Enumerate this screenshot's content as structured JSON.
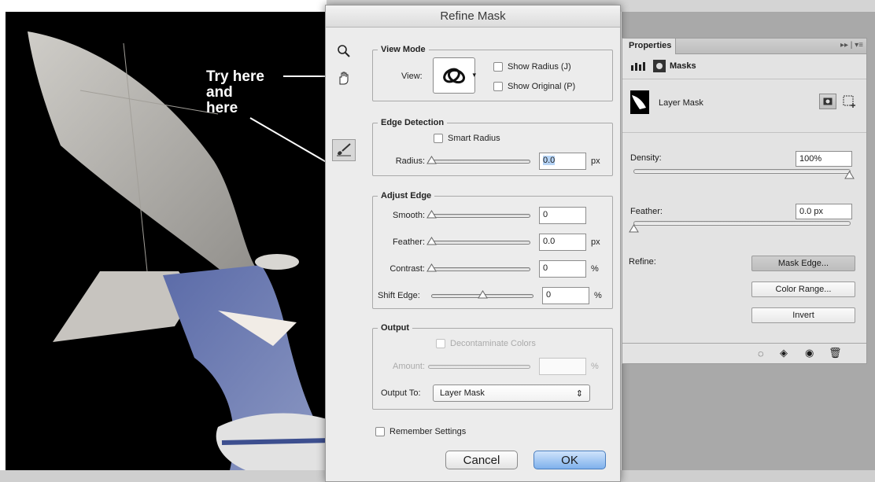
{
  "annotation": {
    "lines": [
      "Try here",
      "and",
      "here"
    ]
  },
  "dialog": {
    "title": "Refine Mask",
    "view_mode": {
      "legend": "View Mode",
      "view_label": "View:",
      "show_radius": "Show Radius (J)",
      "show_original": "Show Original (P)"
    },
    "edge_detection": {
      "legend": "Edge Detection",
      "smart_radius": "Smart Radius",
      "radius_label": "Radius:",
      "radius_value": "0.0",
      "radius_unit": "px"
    },
    "adjust_edge": {
      "legend": "Adjust Edge",
      "smooth_label": "Smooth:",
      "smooth_value": "0",
      "feather_label": "Feather:",
      "feather_value": "0.0",
      "feather_unit": "px",
      "contrast_label": "Contrast:",
      "contrast_value": "0",
      "contrast_unit": "%",
      "shift_label": "Shift Edge:",
      "shift_value": "0",
      "shift_unit": "%"
    },
    "output": {
      "legend": "Output",
      "decontaminate": "Decontaminate Colors",
      "amount_label": "Amount:",
      "amount_unit": "%",
      "output_to_label": "Output To:",
      "output_to_value": "Layer Mask"
    },
    "remember": "Remember Settings",
    "cancel": "Cancel",
    "ok": "OK"
  },
  "properties": {
    "tab": "Properties",
    "section": "Masks",
    "layer_mask": "Layer Mask",
    "density_label": "Density:",
    "density_value": "100%",
    "feather_label": "Feather:",
    "feather_value": "0.0 px",
    "refine_label": "Refine:",
    "mask_edge": "Mask Edge...",
    "color_range": "Color Range...",
    "invert": "Invert"
  },
  "colors": {
    "accent": "#7fb1ec",
    "photo_bg": "#000000",
    "dialog_bg": "#ececec"
  },
  "icons": [
    "zoom-icon",
    "hand-icon",
    "refine-brush-icon",
    "view-thumbnail-icon",
    "mask-icon",
    "vector-mask-icon",
    "selection-icon",
    "apply-icon",
    "visibility-icon",
    "trash-icon"
  ]
}
